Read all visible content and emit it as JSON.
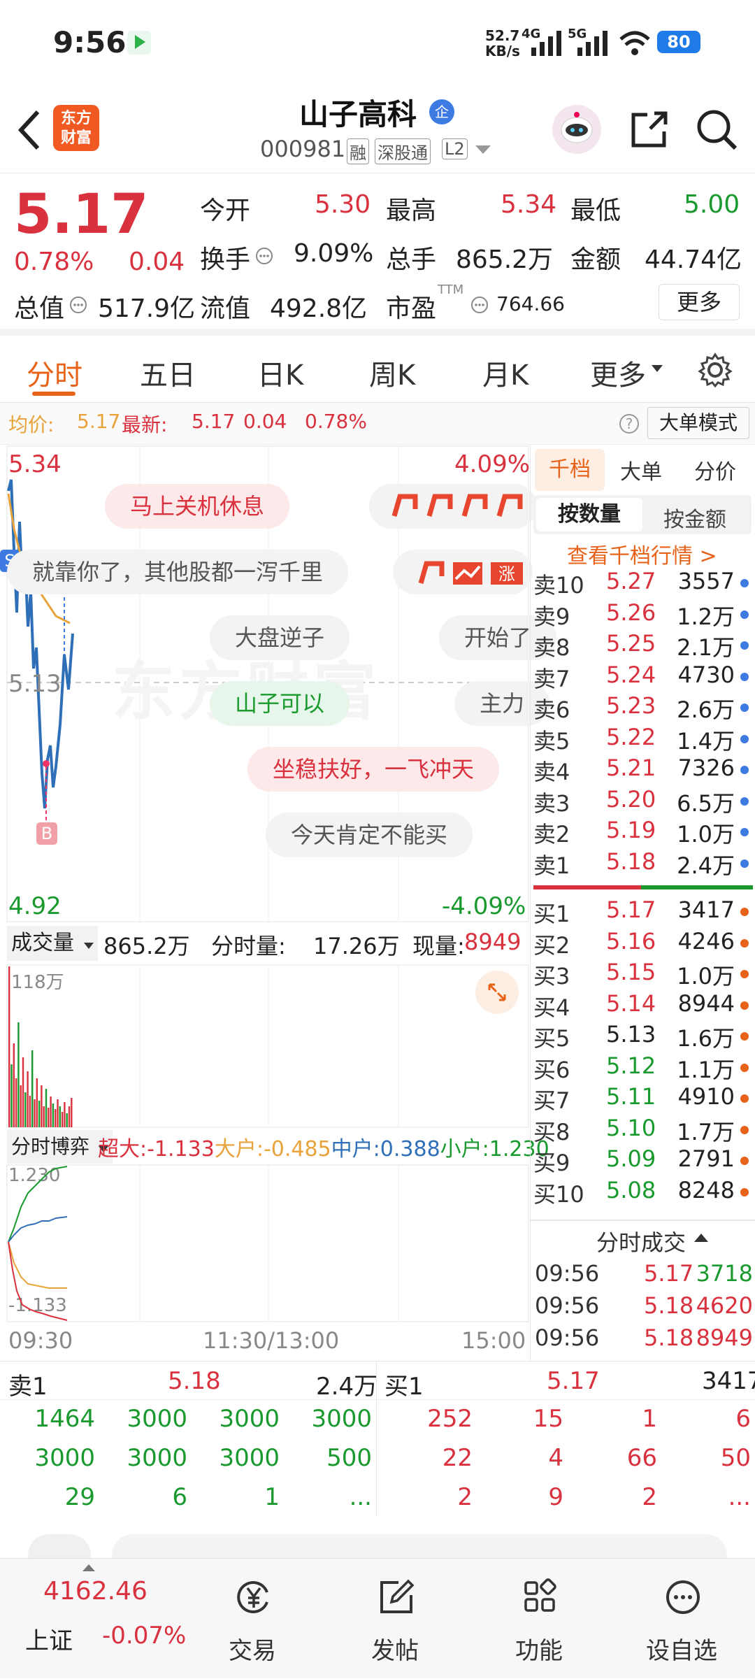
{
  "status": {
    "time": "9:56",
    "speed": "52.7\nKB/s",
    "speed_top": "52.7",
    "speed_bottom": "KB/s",
    "net1": "4G",
    "net2": "5G",
    "battery": "80"
  },
  "header": {
    "logo_line1": "东方",
    "logo_line2": "财富",
    "stock_name": "山子高科",
    "badge": "企",
    "code": "000981",
    "tag1": "融",
    "tag2": "深股通",
    "tag3": "L2"
  },
  "quote": {
    "price": "5.17",
    "pct": "0.78%",
    "change": "0.04",
    "open_label": "今开",
    "open": "5.30",
    "high_label": "最高",
    "high": "5.34",
    "low_label": "最低",
    "low": "5.00",
    "turnover_label": "换手",
    "turnover": "9.09%",
    "volume_label": "总手",
    "volume": "865.2万",
    "amount_label": "金额",
    "amount": "44.74亿",
    "mcap_label": "总值",
    "mcap": "517.9亿",
    "float_label": "流值",
    "float": "492.8亿",
    "pe_label": "市盈",
    "pe_sup": "TTM",
    "pe": "764.66",
    "more": "更多"
  },
  "tabs": [
    "分时",
    "五日",
    "日K",
    "周K",
    "月K",
    "更多"
  ],
  "info": {
    "avg_label": "均价:",
    "avg": "5.17",
    "latest_label": "最新:",
    "latest": "5.17",
    "chg": "0.04",
    "pct": "0.78%",
    "mode": "大单模式"
  },
  "chart": {
    "high": "5.34",
    "high_pct": "4.09%",
    "mid": "5.13",
    "low": "4.92",
    "low_pct": "-4.09%",
    "watermark": "东方财富",
    "s_marker": "S",
    "b_marker": "B"
  },
  "bubbles": [
    "马上关机休息",
    "就靠你了，其他股都一泻千里",
    "大盘逆子",
    "开始了",
    "山子可以",
    "主力",
    "坐稳扶好，一飞冲天",
    "今天肯定不能买"
  ],
  "volume": {
    "label": "成交量",
    "total": "865.2万",
    "tick_label": "分时量:",
    "tick": "17.26万",
    "now_label": "现量:",
    "now": "8949",
    "scale": "118万"
  },
  "flow": {
    "label": "分时博弈",
    "super_label": "超大:",
    "super": "-1.133",
    "big_label": "大户:",
    "big": "-0.485",
    "mid_label": "中户:",
    "mid": "0.388",
    "small_label": "小户:",
    "small": "1.230",
    "top": "1.230",
    "bottom": "-1.133"
  },
  "time_axis": [
    "09:30",
    "11:30/13:00",
    "15:00"
  ],
  "book": {
    "tab1": "千档",
    "tab2": "大单",
    "tab3": "分价",
    "sub1": "按数量",
    "sub2": "按金额",
    "link": "查看千档行情 >",
    "asks": [
      {
        "label": "卖10",
        "price": "5.27",
        "vol": "3557"
      },
      {
        "label": "卖9",
        "price": "5.26",
        "vol": "1.2万"
      },
      {
        "label": "卖8",
        "price": "5.25",
        "vol": "2.1万"
      },
      {
        "label": "卖7",
        "price": "5.24",
        "vol": "4730"
      },
      {
        "label": "卖6",
        "price": "5.23",
        "vol": "2.6万"
      },
      {
        "label": "卖5",
        "price": "5.22",
        "vol": "1.4万"
      },
      {
        "label": "卖4",
        "price": "5.21",
        "vol": "7326"
      },
      {
        "label": "卖3",
        "price": "5.20",
        "vol": "6.5万"
      },
      {
        "label": "卖2",
        "price": "5.19",
        "vol": "1.0万"
      },
      {
        "label": "卖1",
        "price": "5.18",
        "vol": "2.4万"
      }
    ],
    "bids": [
      {
        "label": "买1",
        "price": "5.17",
        "vol": "3417"
      },
      {
        "label": "买2",
        "price": "5.16",
        "vol": "4246"
      },
      {
        "label": "买3",
        "price": "5.15",
        "vol": "1.0万"
      },
      {
        "label": "买4",
        "price": "5.14",
        "vol": "8944"
      },
      {
        "label": "买5",
        "price": "5.13",
        "vol": "1.6万"
      },
      {
        "label": "买6",
        "price": "5.12",
        "vol": "1.1万"
      },
      {
        "label": "买7",
        "price": "5.11",
        "vol": "4910"
      },
      {
        "label": "买8",
        "price": "5.10",
        "vol": "1.7万"
      },
      {
        "label": "买9",
        "price": "5.09",
        "vol": "2791"
      },
      {
        "label": "买10",
        "price": "5.08",
        "vol": "8248"
      }
    ],
    "trades_title": "分时成交",
    "trades": [
      {
        "time": "09:56",
        "price": "5.17",
        "vol": "3718"
      },
      {
        "time": "09:56",
        "price": "5.18",
        "vol": "4620"
      },
      {
        "time": "09:56",
        "price": "5.18",
        "vol": "8949"
      }
    ]
  },
  "queue": {
    "ask_label": "卖1",
    "ask_price": "5.18",
    "ask_vol": "2.4万",
    "bid_label": "买1",
    "bid_price": "5.17",
    "bid_vol": "3417",
    "ask_rows": [
      [
        "1464",
        "3000",
        "3000",
        "3000"
      ],
      [
        "3000",
        "3000",
        "3000",
        "500"
      ],
      [
        "29",
        "6",
        "1",
        "..."
      ]
    ],
    "bid_rows": [
      [
        "252",
        "15",
        "1",
        "6"
      ],
      [
        "22",
        "4",
        "66",
        "50"
      ],
      [
        "2",
        "9",
        "2",
        "..."
      ]
    ]
  },
  "bottom": {
    "index_value": "4162.46",
    "index_name": "上证",
    "index_pct": "-0.07%",
    "nav": [
      "交易",
      "发帖",
      "功能",
      "设自选"
    ]
  },
  "colors": {
    "up": "#d9313e",
    "down": "#1a9a2e",
    "accent": "#e8631a",
    "avg_line": "#e8a33a",
    "price_line": "#2f6fb8"
  }
}
